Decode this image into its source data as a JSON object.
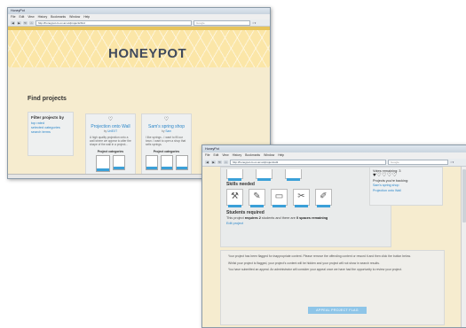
{
  "window1": {
    "title": "HoneyPot",
    "menu": [
      "File",
      "Edit",
      "View",
      "History",
      "Bookmarks",
      "Window",
      "Help"
    ],
    "url": "http://honeypot.cs.ox.ac.uk/projects/find",
    "search_placeholder": "Google",
    "logo": "HONEYPOT",
    "find_title": "Find projects",
    "filter": {
      "heading": "Filter projects by",
      "links": [
        "top rated",
        "selected categories",
        "search terms"
      ]
    },
    "cards": [
      {
        "title": "Projection onto Wall",
        "by_prefix": "by",
        "author": "UniEXT",
        "description": "A high quality projection onto a wall where we appear to alter the shape of the wall in a project...",
        "categories_label": "Project categories"
      },
      {
        "title": "Sam's spring shop",
        "by_prefix": "by",
        "author": "Sam",
        "description": "I like springs - I want to fill our town. I want to open a shop that sells springs.",
        "categories_label": "Project categories"
      }
    ]
  },
  "window2": {
    "title": "HoneyPot",
    "menu": [
      "File",
      "Edit",
      "View",
      "History",
      "Bookmarks",
      "Window",
      "Help"
    ],
    "url": "http://honeypot.cs.ox.ac.uk/project/edit",
    "search_placeholder": "Google",
    "votes_remaining": "Votes remaining: 3",
    "hearts": "♥♡♡♡♡",
    "backing_header": "Projects you're backing:",
    "backing": [
      "Sam's spring shop",
      "Projection onto Wall"
    ],
    "skills_title": "Skills needed",
    "students_title": "Students required",
    "students_text_pre": "This project",
    "students_requires": "requires 2",
    "students_text_mid": "students and there are",
    "students_spaces": "0 spaces remaining",
    "edit_link": "Edit project",
    "flag_paragraphs": [
      "Your project has been flagged for inappropriate content. Please remove the offending content or reword it and then click the button below.",
      "Whilst your project is flagged, your project's content will be hidden and your project will not show in search results.",
      "You have submitted an appeal. An administrator will consider your appeal once we have had the opportunity to review your project."
    ],
    "appeal_button": "APPEAL PROJECT FLAG"
  }
}
